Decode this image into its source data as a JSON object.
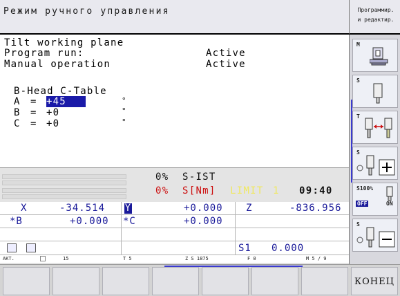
{
  "header": {
    "title": "Режим ручного управления",
    "mode_line1": "Программир.",
    "mode_line2": "и редактир."
  },
  "tilt": {
    "heading": "Tilt working plane",
    "program_run_label": "Program run:",
    "program_run_value": "Active",
    "manual_label": "Manual operation",
    "manual_value": "Active",
    "kinematics": "B-Head C-Table",
    "axes": [
      {
        "name": "A",
        "eq": "=",
        "value": "+45",
        "unit": "°",
        "selected": true
      },
      {
        "name": "B",
        "eq": "=",
        "value": "+0",
        "unit": "°",
        "selected": false
      },
      {
        "name": "C",
        "eq": "=",
        "value": "+0",
        "unit": "°",
        "selected": false
      }
    ]
  },
  "status": {
    "s_ist_pct": "0%",
    "s_ist_label": "S-IST",
    "s_nm_pct": "0%",
    "s_nm_label": "S[Nm]",
    "limit_label": "LIMIT",
    "limit_value": "1",
    "time": "09:40"
  },
  "positions": {
    "row1": [
      {
        "axis": "X",
        "value": "-34.514"
      },
      {
        "axis": "Y",
        "value": "+0.000"
      },
      {
        "axis": "Z",
        "value": "-836.956"
      }
    ],
    "row2": [
      {
        "axis": "*B",
        "value": "+0.000"
      },
      {
        "axis": "*C",
        "value": "+0.000"
      }
    ],
    "spindle_label": "S1",
    "spindle_value": "0.000"
  },
  "info_row": {
    "akt": "AKT.",
    "tool_icon_text": "15",
    "t_value": "T 5",
    "z_s": "Z S 1875",
    "f_value": "F 0",
    "m_value": "M 5 / 9"
  },
  "right_softkeys": [
    {
      "label": "M",
      "icon": "machine-table-icon"
    },
    {
      "label": "S",
      "icon": "spindle-icon"
    },
    {
      "label": "T",
      "icon": "tool-change-icon"
    },
    {
      "label": "S",
      "icon": "spindle-plus-icon"
    },
    {
      "label": "S100%",
      "icon": "spindle-override-icon",
      "off": "OFF",
      "on": "ON"
    },
    {
      "label": "S",
      "icon": "spindle-minus-icon"
    }
  ],
  "bottom_softkeys": [
    "",
    "",
    "",
    "",
    "",
    "",
    "",
    "КОНЕЦ"
  ],
  "colors": {
    "selection": "#1a1aa8",
    "axis_blue": "#1a1a9a",
    "limit_yellow": "#f0e860",
    "alert_red": "#cc1010"
  }
}
